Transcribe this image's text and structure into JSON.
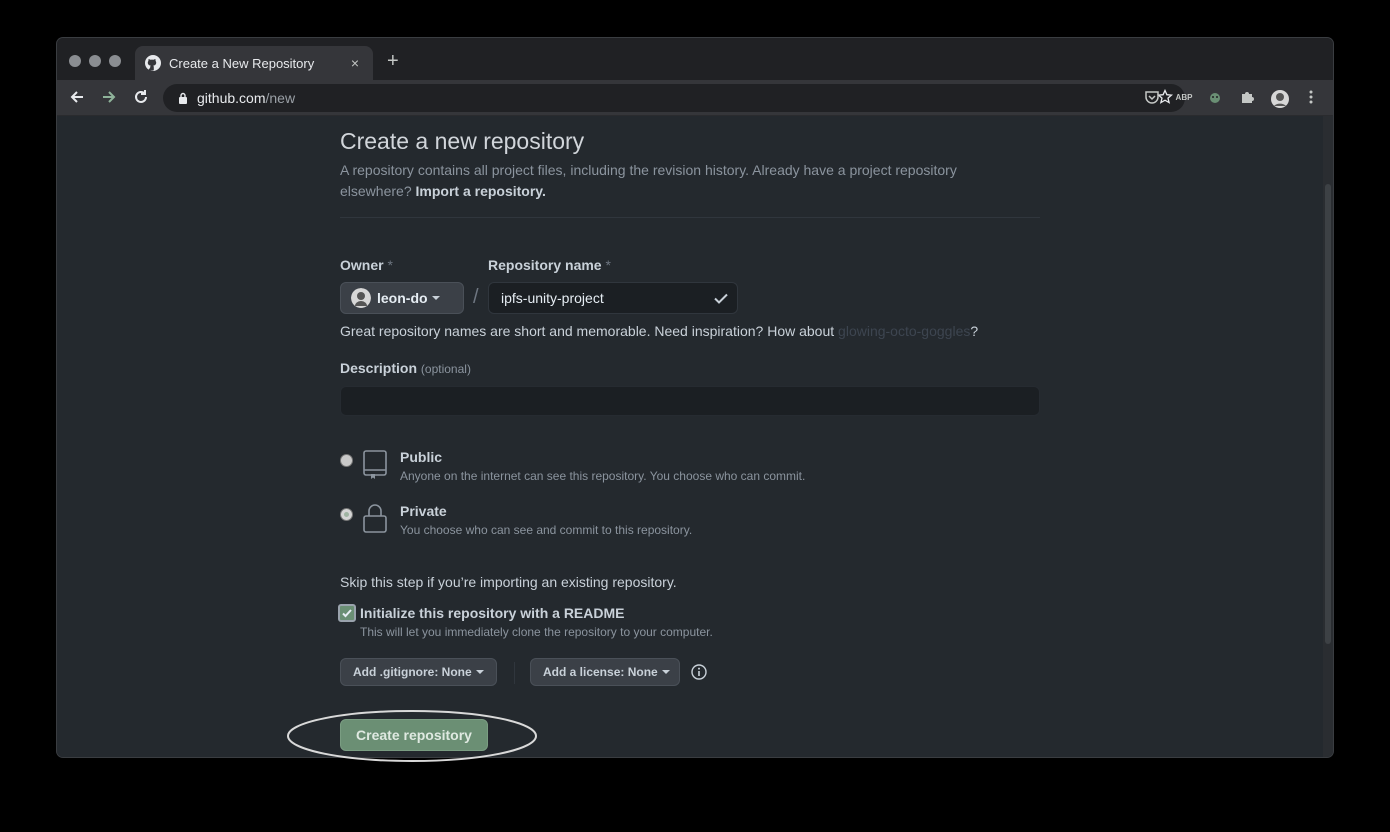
{
  "browser": {
    "tab_title": "Create a New Repository",
    "tab_close": "×",
    "new_tab": "+",
    "url_domain": "github.com",
    "url_path": "/new",
    "extensions": [
      "pocket-icon",
      "abp-icon",
      "extension-icon",
      "puzzle-icon",
      "profile-icon",
      "menu-icon"
    ],
    "abp_label": "ABP"
  },
  "page": {
    "title": "Create a new repository",
    "subtitle": "A repository contains all project files, including the revision history. Already have a project repository elsewhere?",
    "import_link": "Import a repository.",
    "owner_label": "Owner",
    "repo_name_label": "Repository name",
    "required_mark": "*",
    "owner_value": "leon-do",
    "slash": "/",
    "repo_name_value": "ipfs-unity-project",
    "hint_prefix": "Great repository names are short and memorable. Need inspiration? How about",
    "hint_suggestion": "glowing-octo-goggles",
    "hint_suffix": "?",
    "description_label": "Description",
    "description_optional": "(optional)",
    "description_value": "",
    "visibility": {
      "public_title": "Public",
      "public_desc": "Anyone on the internet can see this repository. You choose who can commit.",
      "public_checked": false,
      "private_title": "Private",
      "private_desc": "You choose who can see and commit to this repository.",
      "private_checked": true
    },
    "skip_text": "Skip this step if you’re importing an existing repository.",
    "readme_title": "Initialize this repository with a README",
    "readme_desc": "This will let you immediately clone the repository to your computer.",
    "readme_checked": true,
    "gitignore_button": "Add .gitignore: None",
    "license_button": "Add a license: None",
    "create_button": "Create repository"
  },
  "colors": {
    "background": "#24292e",
    "create_button": "#6b8f74",
    "chrome_tabstrip": "#202124",
    "chrome_toolbar": "#35363a"
  }
}
